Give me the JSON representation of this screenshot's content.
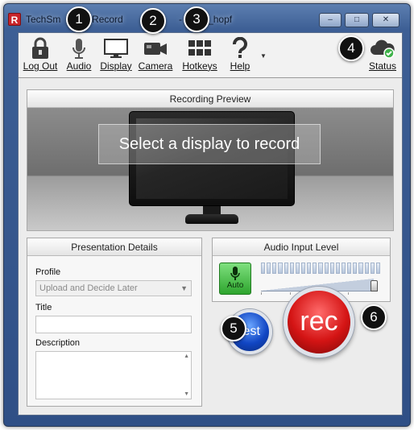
{
  "window": {
    "title": "TechSm      lay Record        -Ho       - jenny_hopf",
    "app_icon_letter": "R",
    "minimize": "–",
    "maximize": "□",
    "close": "✕"
  },
  "toolbar": {
    "items": [
      {
        "label": "Log Out",
        "icon": "lock-icon"
      },
      {
        "label": "Audio",
        "icon": "microphone-icon"
      },
      {
        "label": "Display",
        "icon": "monitor-icon"
      },
      {
        "label": "Camera",
        "icon": "camera-icon"
      },
      {
        "label": "Hotkeys",
        "icon": "grid-icon"
      },
      {
        "label": "Help",
        "icon": "question-icon"
      },
      {
        "label": "Status",
        "icon": "cloud-check-icon"
      }
    ],
    "help_dropdown": "▼"
  },
  "callouts": [
    "1",
    "2",
    "3",
    "4",
    "5",
    "6"
  ],
  "preview": {
    "header": "Recording Preview",
    "overlay_text": "Select a display to record"
  },
  "details": {
    "header": "Presentation Details",
    "profile_label": "Profile",
    "profile_value": "Upload and Decide Later",
    "title_label": "Title",
    "title_value": "",
    "description_label": "Description"
  },
  "audio": {
    "header": "Audio Input Level",
    "auto_label": "Auto",
    "level_segments": 21,
    "volume_level": 0.97
  },
  "actions": {
    "test_label": "test",
    "rec_label": "rec"
  }
}
